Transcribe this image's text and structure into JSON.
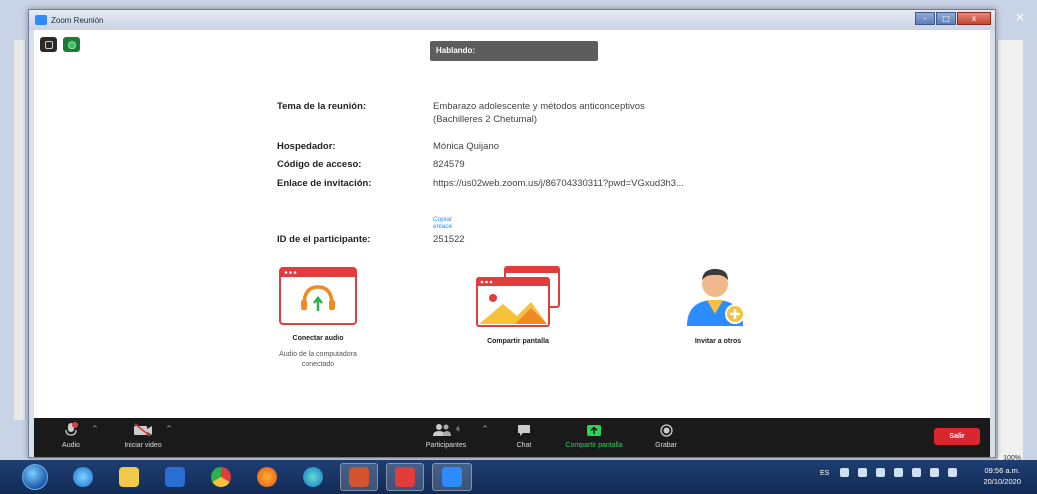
{
  "window": {
    "title": "Zoom Reunión",
    "controls": [
      "–",
      "□",
      "x"
    ]
  },
  "background": {
    "close_glyph": "×",
    "zoom_level": "100%"
  },
  "meeting": {
    "speaking_label": "Hablando:",
    "topic_label": "Tema de la reunión:",
    "topic_line1": "Embarazo adolescente y métodos anticonceptivos",
    "topic_line2": "(Bachilleres 2 Chetumal)",
    "host_label": "Hospedador:",
    "host_value": "Mónica Quijano",
    "passcode_label": "Código de acceso:",
    "passcode_value": "824579",
    "invite_label": "Enlace de invitación:",
    "invite_value": "https://us02web.zoom.us/j/86704330311?pwd=VGxud3h3...",
    "copy_link": "Copiar enlace",
    "participant_id_label": "ID de el participante:",
    "participant_id_value": "251522"
  },
  "actions": {
    "audio_label": "Conectar audio",
    "audio_sub_line1": "Audio de la computadora",
    "audio_sub_line2": "conectado",
    "share_label": "Compartir pantalla",
    "invite_label": "Invitar a otros"
  },
  "toolbar": {
    "audio": "Audio",
    "video": "Iniciar video",
    "participants": "Participantes",
    "participants_count": "6",
    "chat": "Chat",
    "share": "Compartir pantalla",
    "record": "Grabar",
    "leave": "Salir",
    "caret": "^"
  },
  "taskbar": {
    "language": "ES",
    "time": "09:56 a.m.",
    "date": "20/10/2020"
  },
  "colors": {
    "accent_red": "#e23c3c",
    "zoom_blue": "#2d8cff",
    "share_green": "#2bd35a",
    "leave_red": "#d9262f"
  }
}
